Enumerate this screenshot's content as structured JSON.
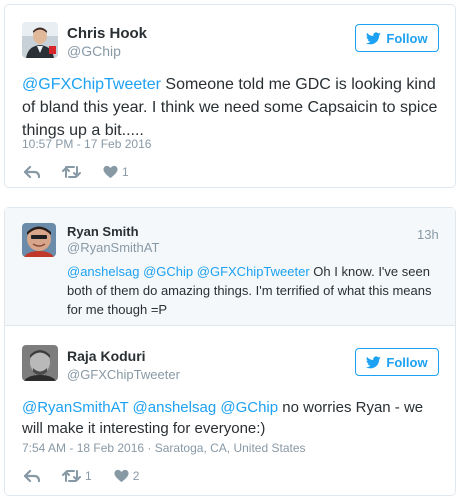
{
  "tweet1": {
    "author_name": "Chris Hook",
    "author_handle": "@GChip",
    "follow_label": "Follow",
    "text_parts": {
      "m1": "@GFXChipTweeter",
      "t1": " Someone told me GDC is looking kind of bland this year. I think we need some Capsaicin to spice things up a bit....."
    },
    "timestamp": "10:57 PM - 17 Feb 2016",
    "like_count": "1"
  },
  "tweet2": {
    "author_name": "Ryan Smith",
    "author_handle": "@RyanSmithAT",
    "time_ago": "13h",
    "text_parts": {
      "m1": "@anshelsag",
      "m2": "@GChip",
      "m3": "@GFXChipTweeter",
      "t1": " Oh I know. I've seen both of them do amazing things. I'm terrified of what this means for me though =P"
    }
  },
  "tweet3": {
    "author_name": "Raja Koduri",
    "author_handle": "@GFXChipTweeter",
    "follow_label": "Follow",
    "text_parts": {
      "m1": "@RyanSmithAT",
      "m2": "@anshelsag",
      "m3": "@GChip",
      "t1": " no worries Ryan - we will make it interesting for everyone:)"
    },
    "timestamp": "7:54 AM - 18 Feb 2016 · Saratoga, CA, United States",
    "retweet_count": "1",
    "like_count": "2"
  },
  "colors": {
    "accent": "#1da1f2",
    "muted": "#8899a6",
    "text": "#292f33",
    "border": "#e1e8ed",
    "reply_bg": "#f5f8fa"
  },
  "icons": [
    "twitter-bird-icon",
    "reply-icon",
    "retweet-icon",
    "heart-icon"
  ]
}
